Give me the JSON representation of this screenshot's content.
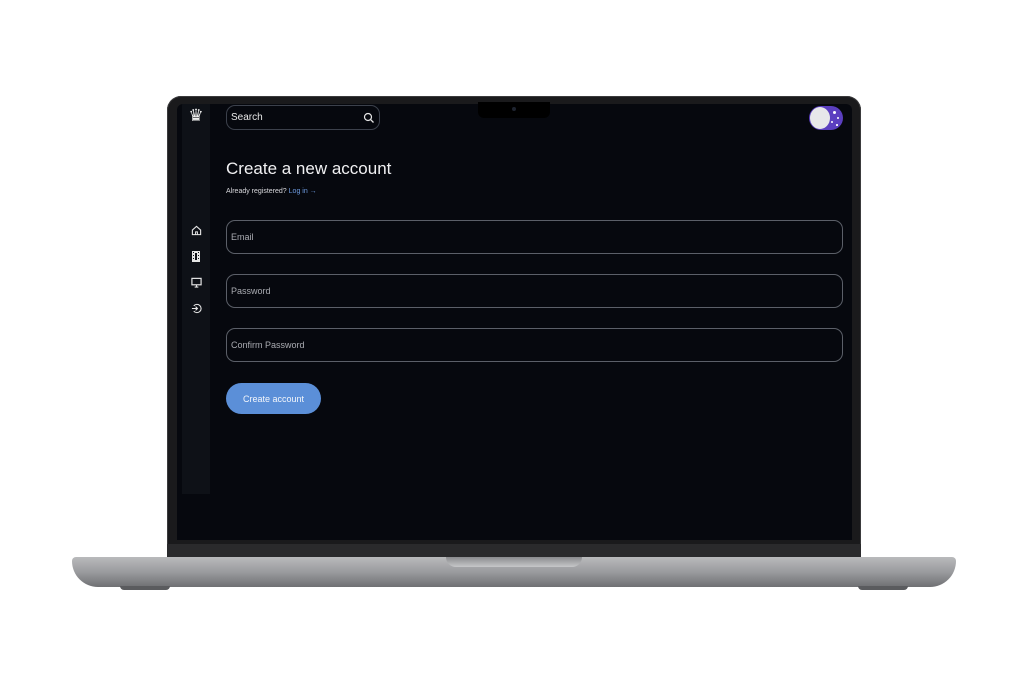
{
  "app": {
    "logo_icon": "crown-icon"
  },
  "search": {
    "placeholder": "Search",
    "icon": "search-icon"
  },
  "sidebar": {
    "items": [
      {
        "icon": "home-icon"
      },
      {
        "icon": "film-icon"
      },
      {
        "icon": "monitor-icon"
      },
      {
        "icon": "login-icon"
      }
    ]
  },
  "theme_toggle": {
    "icon": "moon-stars-icon",
    "accent": "#5b3fc0"
  },
  "page": {
    "title": "Create a new account",
    "already_text": "Already registered?",
    "login_link": "Log in →"
  },
  "form": {
    "email_placeholder": "Email",
    "password_placeholder": "Password",
    "confirm_placeholder": "Confirm Password",
    "submit_label": "Create account"
  },
  "colors": {
    "background": "#06080e",
    "accent": "#5b8fd8",
    "link": "#6e9be0"
  }
}
